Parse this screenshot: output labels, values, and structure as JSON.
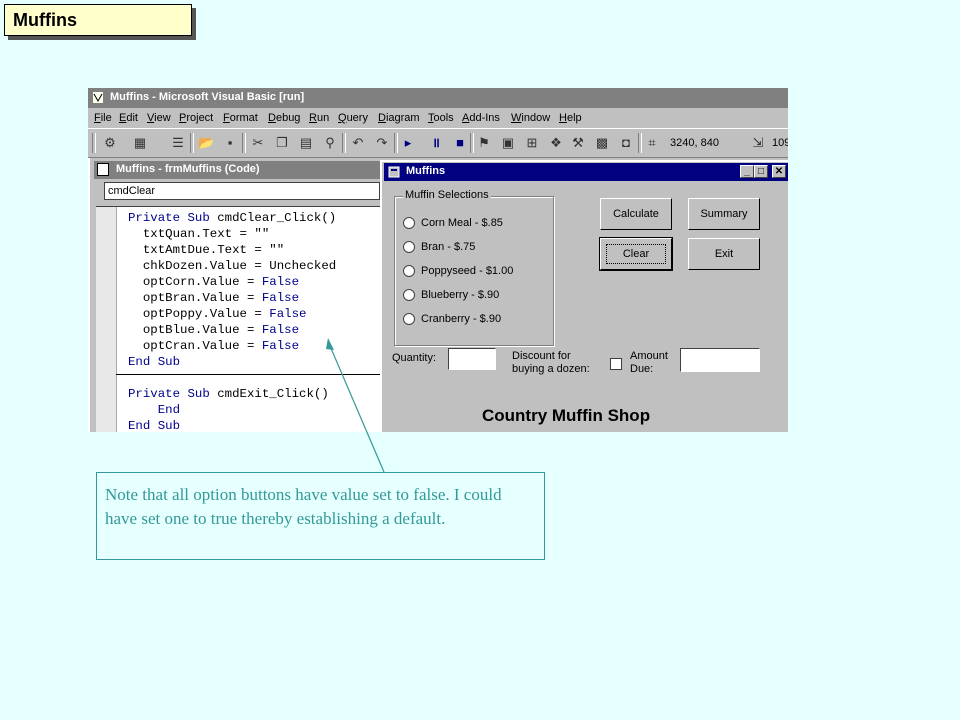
{
  "slide": {
    "title": "Muffins",
    "callout": "Note that all option buttons have value set to false.  I could have set one to true thereby establishing a default."
  },
  "ide": {
    "title": "Muffins - Microsoft Visual Basic [run]",
    "menu": [
      "File",
      "Edit",
      "View",
      "Project",
      "Format",
      "Debug",
      "Run",
      "Query",
      "Diagram",
      "Tools",
      "Add-Ins",
      "Window",
      "Help"
    ],
    "toolbar_icons": [
      "add-project-icon",
      "add-form-icon",
      "menu-editor-icon",
      "open-icon",
      "save-icon",
      "cut-icon",
      "copy-icon",
      "paste-icon",
      "find-icon",
      "undo-icon",
      "redo-icon",
      "start-icon",
      "break-icon",
      "end-icon",
      "project-explorer-icon",
      "properties-icon",
      "form-layout-icon",
      "object-browser-icon",
      "toolbox-icon",
      "data-view-icon",
      "component-manager-icon"
    ],
    "coords": "3240, 840",
    "size_partial": "109"
  },
  "code_window": {
    "title": "Muffins - frmMuffins (Code)",
    "object": "cmdClear",
    "lines": [
      {
        "kw": "Private Sub ",
        "rest": "cmdClear_Click()",
        "indent": 0
      },
      {
        "kw": "",
        "rest": "txtQuan.Text = \"\"",
        "indent": 1
      },
      {
        "kw": "",
        "rest": "txtAmtDue.Text = \"\"",
        "indent": 1
      },
      {
        "kw": "",
        "rest": "chkDozen.Value = Unchecked",
        "indent": 1
      },
      {
        "kw": "",
        "rest": "optCorn.Value = ",
        "val": "False",
        "indent": 1
      },
      {
        "kw": "",
        "rest": "optBran.Value = ",
        "val": "False",
        "indent": 1
      },
      {
        "kw": "",
        "rest": "optPoppy.Value = ",
        "val": "False",
        "indent": 1
      },
      {
        "kw": "",
        "rest": "optBlue.Value = ",
        "val": "False",
        "indent": 1
      },
      {
        "kw": "",
        "rest": "optCran.Value = ",
        "val": "False",
        "indent": 1
      },
      {
        "kw": "End Sub",
        "rest": "",
        "indent": 0
      },
      {
        "kw": "",
        "rest": "",
        "indent": 0
      },
      {
        "kw": "Private Sub ",
        "rest": "cmdExit_Click()",
        "indent": 0
      },
      {
        "kw": "End",
        "rest": "",
        "indent": 2
      },
      {
        "kw": "End Sub",
        "rest": "",
        "indent": 0
      }
    ]
  },
  "form": {
    "title": "Muffins",
    "group_label": "Muffin Selections",
    "options": [
      "Corn Meal - $.85",
      "Bran - $.75",
      "Poppyseed - $1.00",
      "Blueberry - $.90",
      "Cranberry - $.90"
    ],
    "buttons": {
      "calculate": "Calculate",
      "summary": "Summary",
      "clear": "Clear",
      "exit": "Exit"
    },
    "quantity_label": "Quantity:",
    "discount_label": "Discount for buying a dozen:",
    "amount_label": "Amount Due:",
    "shop_title": "Country Muffin Shop"
  },
  "colors": {
    "background": "#e6ffff",
    "callout": "#339999",
    "keyword": "#00008b",
    "form_titlebar": "#000080"
  }
}
